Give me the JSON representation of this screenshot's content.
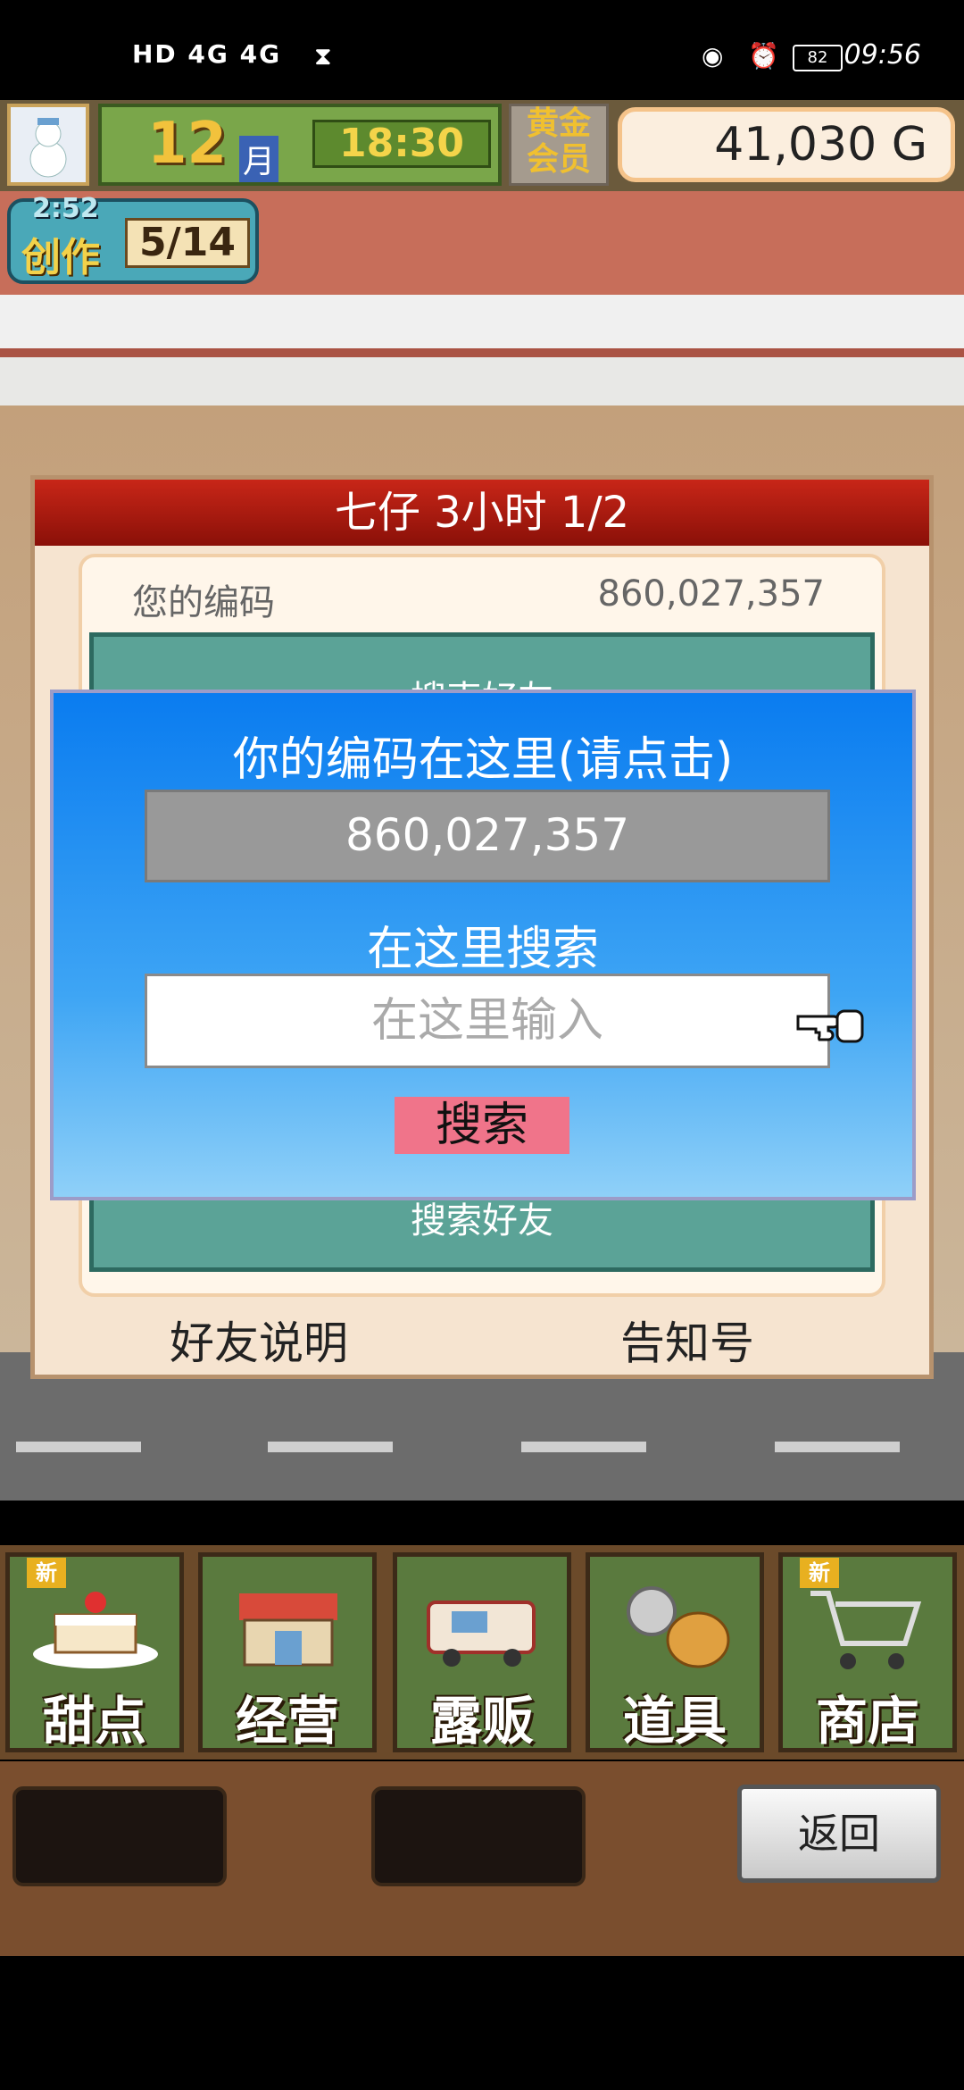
{
  "status_bar": {
    "left_indicators": "HD 4G 4G",
    "time": "09:56",
    "battery": "82"
  },
  "hud": {
    "month_number": "12",
    "month_label": "月",
    "clock": "18:30",
    "gold_member_label": "黄金会员",
    "money": "41,030 G"
  },
  "craft": {
    "timer": "2:52",
    "label": "创作",
    "count": "5/14"
  },
  "dialog": {
    "title": "七仔  3小时 1/2",
    "your_code_label": "您的编码",
    "your_code_value": "860,027,357",
    "green_header": "搜索好友",
    "green_footer": "搜索好友",
    "left_button": "好友说明",
    "right_button": "告知号"
  },
  "modal": {
    "title": "你的编码在这里(请点击)",
    "code": "860,027,357",
    "search_title": "在这里搜索",
    "search_placeholder": "在这里输入",
    "search_button": "搜索"
  },
  "menu": {
    "items": [
      {
        "label": "甜点",
        "new_badge": "新",
        "icon": "cake-icon"
      },
      {
        "label": "经营",
        "icon": "shop-building-icon"
      },
      {
        "label": "露贩",
        "icon": "food-truck-icon"
      },
      {
        "label": "道具",
        "icon": "items-bag-icon"
      },
      {
        "label": "商店",
        "new_badge": "新",
        "icon": "cart-icon"
      }
    ],
    "back_button": "返回"
  },
  "colors": {
    "modal_blue": "#0a7cf0",
    "dialog_red": "#c82618",
    "search_button_pink": "#f0748a",
    "menu_green": "#5a7a3e"
  }
}
